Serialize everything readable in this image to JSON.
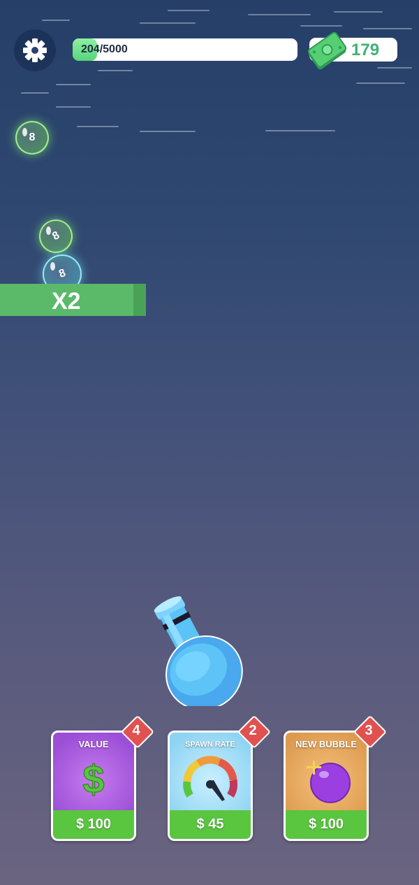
{
  "hud": {
    "progress_text": "204/5000",
    "progress_fraction": 0.0408,
    "cash_amount": "179"
  },
  "bubbles": [
    {
      "value": "8",
      "color": "green"
    },
    {
      "value": "8",
      "color": "green"
    },
    {
      "value": "8",
      "color": "cyan"
    }
  ],
  "multiplier": {
    "label": "X2"
  },
  "upgrades": [
    {
      "title": "VALUE",
      "price": "$ 100",
      "level": "4",
      "icon": "dollar-icon"
    },
    {
      "title": "SPAWN RATE",
      "price": "$ 45",
      "level": "2",
      "icon": "gauge-icon"
    },
    {
      "title": "NEW BUBBLE",
      "price": "$ 100",
      "level": "3",
      "icon": "bubble-icon"
    }
  ],
  "colors": {
    "accent_green": "#5ac53f",
    "badge_red": "#e0514f",
    "cash_green": "#3fb273"
  }
}
